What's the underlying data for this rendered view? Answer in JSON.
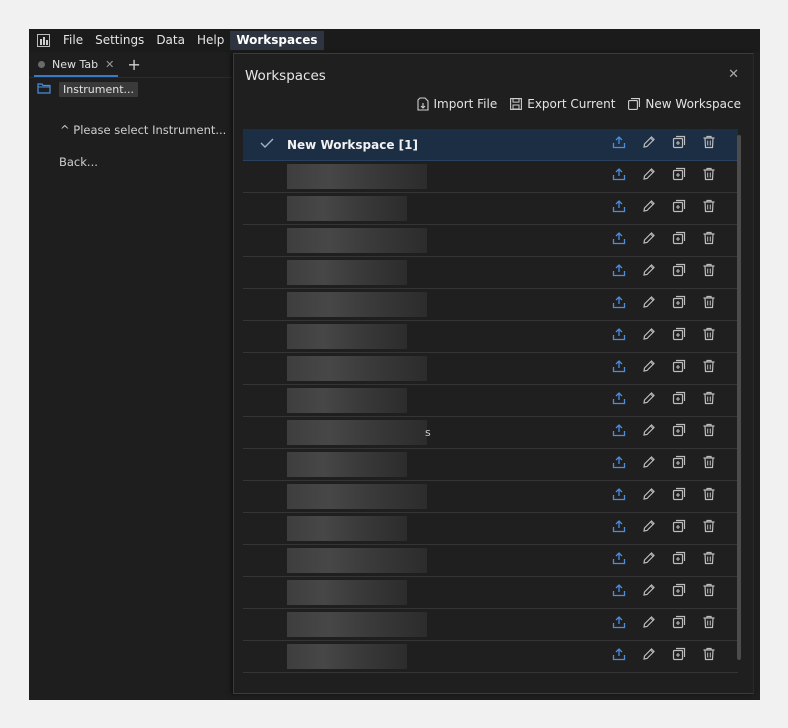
{
  "menu": {
    "items": [
      "File",
      "Settings",
      "Data",
      "Help",
      "Workspaces"
    ],
    "active": "Workspaces"
  },
  "tabs": [
    {
      "label": "New Tab"
    }
  ],
  "sidebar": {
    "instrument_button": "Instrument...",
    "hint": "^ Please select Instrument...",
    "back": "Back..."
  },
  "dialog": {
    "title": "Workspaces",
    "toolbar": {
      "import_label": "Import File",
      "export_label": "Export Current",
      "new_label": "New Workspace"
    },
    "workspaces": [
      {
        "name": "New Workspace [1]",
        "selected": true
      },
      {
        "name": "",
        "redacted": true
      },
      {
        "name": "",
        "redacted": true
      },
      {
        "name": "",
        "redacted": true
      },
      {
        "name": "",
        "redacted": true
      },
      {
        "name": "",
        "redacted": true
      },
      {
        "name": "",
        "redacted": true
      },
      {
        "name": "",
        "redacted": true
      },
      {
        "name": "",
        "redacted": true
      },
      {
        "name": "",
        "redacted": true,
        "suffix": "s"
      },
      {
        "name": "",
        "redacted": true
      },
      {
        "name": "",
        "redacted": true
      },
      {
        "name": "",
        "redacted": true
      },
      {
        "name": "",
        "redacted": true
      },
      {
        "name": "",
        "redacted": true
      },
      {
        "name": "",
        "redacted": true
      },
      {
        "name": "",
        "redacted": true
      }
    ]
  },
  "colors": {
    "accent": "#3a78c8",
    "selected_row": "#1c2e44",
    "background": "#1e1e1e",
    "upload_icon": "#4a8fe0"
  },
  "icons": {
    "row_actions": [
      "upload-icon",
      "edit-icon",
      "duplicate-icon",
      "delete-icon"
    ]
  }
}
